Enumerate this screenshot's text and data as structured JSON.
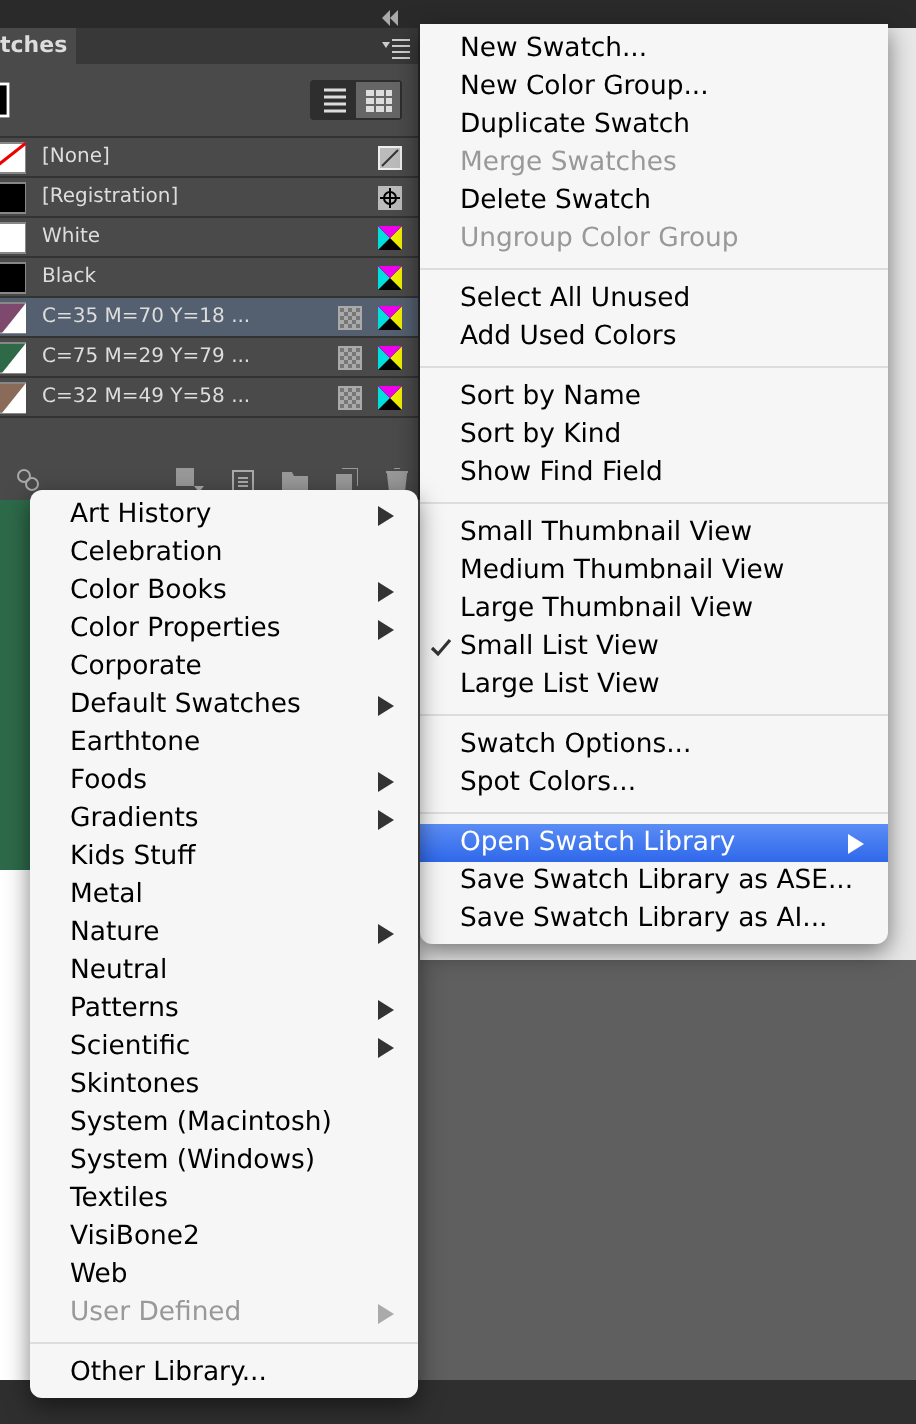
{
  "panel": {
    "tab": "tches",
    "swatches": [
      {
        "name": "[None]",
        "color": "#ffffff",
        "kind": "none",
        "selected": false,
        "global": false
      },
      {
        "name": "[Registration]",
        "color": "#000000",
        "kind": "registration",
        "selected": false,
        "global": false
      },
      {
        "name": "White",
        "color": "#ffffff",
        "kind": "process",
        "selected": false,
        "global": false
      },
      {
        "name": "Black",
        "color": "#000000",
        "kind": "process",
        "selected": false,
        "global": false
      },
      {
        "name": "C=35 M=70 Y=18 ...",
        "color": "#7d4a6e",
        "kind": "process",
        "selected": true,
        "global": true
      },
      {
        "name": "C=75 M=29 Y=79 ...",
        "color": "#2e6a48",
        "kind": "process",
        "selected": false,
        "global": true
      },
      {
        "name": "C=32 M=49 Y=58 ...",
        "color": "#8a6a58",
        "kind": "process",
        "selected": false,
        "global": true
      }
    ]
  },
  "menu": {
    "sections": [
      [
        {
          "label": "New Swatch...",
          "disabled": false,
          "checked": false,
          "submenu": false,
          "selected": false
        },
        {
          "label": "New Color Group...",
          "disabled": false,
          "checked": false,
          "submenu": false,
          "selected": false
        },
        {
          "label": "Duplicate Swatch",
          "disabled": false,
          "checked": false,
          "submenu": false,
          "selected": false
        },
        {
          "label": "Merge Swatches",
          "disabled": true,
          "checked": false,
          "submenu": false,
          "selected": false
        },
        {
          "label": "Delete Swatch",
          "disabled": false,
          "checked": false,
          "submenu": false,
          "selected": false
        },
        {
          "label": "Ungroup Color Group",
          "disabled": true,
          "checked": false,
          "submenu": false,
          "selected": false
        }
      ],
      [
        {
          "label": "Select All Unused",
          "disabled": false,
          "checked": false,
          "submenu": false,
          "selected": false
        },
        {
          "label": "Add Used Colors",
          "disabled": false,
          "checked": false,
          "submenu": false,
          "selected": false
        }
      ],
      [
        {
          "label": "Sort by Name",
          "disabled": false,
          "checked": false,
          "submenu": false,
          "selected": false
        },
        {
          "label": "Sort by Kind",
          "disabled": false,
          "checked": false,
          "submenu": false,
          "selected": false
        },
        {
          "label": "Show Find Field",
          "disabled": false,
          "checked": false,
          "submenu": false,
          "selected": false
        }
      ],
      [
        {
          "label": "Small Thumbnail View",
          "disabled": false,
          "checked": false,
          "submenu": false,
          "selected": false
        },
        {
          "label": "Medium Thumbnail View",
          "disabled": false,
          "checked": false,
          "submenu": false,
          "selected": false
        },
        {
          "label": "Large Thumbnail View",
          "disabled": false,
          "checked": false,
          "submenu": false,
          "selected": false
        },
        {
          "label": "Small List View",
          "disabled": false,
          "checked": true,
          "submenu": false,
          "selected": false
        },
        {
          "label": "Large List View",
          "disabled": false,
          "checked": false,
          "submenu": false,
          "selected": false
        }
      ],
      [
        {
          "label": "Swatch Options...",
          "disabled": false,
          "checked": false,
          "submenu": false,
          "selected": false
        },
        {
          "label": "Spot Colors...",
          "disabled": false,
          "checked": false,
          "submenu": false,
          "selected": false
        }
      ],
      [
        {
          "label": "Open Swatch Library",
          "disabled": false,
          "checked": false,
          "submenu": true,
          "selected": true
        },
        {
          "label": "Save Swatch Library as ASE...",
          "disabled": false,
          "checked": false,
          "submenu": false,
          "selected": false
        },
        {
          "label": "Save Swatch Library as AI...",
          "disabled": false,
          "checked": false,
          "submenu": false,
          "selected": false
        }
      ]
    ]
  },
  "library_menu": {
    "sections": [
      [
        {
          "label": "Art History",
          "disabled": false,
          "submenu": true
        },
        {
          "label": "Celebration",
          "disabled": false,
          "submenu": false
        },
        {
          "label": "Color Books",
          "disabled": false,
          "submenu": true
        },
        {
          "label": "Color Properties",
          "disabled": false,
          "submenu": true
        },
        {
          "label": "Corporate",
          "disabled": false,
          "submenu": false
        },
        {
          "label": "Default Swatches",
          "disabled": false,
          "submenu": true
        },
        {
          "label": "Earthtone",
          "disabled": false,
          "submenu": false
        },
        {
          "label": "Foods",
          "disabled": false,
          "submenu": true
        },
        {
          "label": "Gradients",
          "disabled": false,
          "submenu": true
        },
        {
          "label": "Kids Stuff",
          "disabled": false,
          "submenu": false
        },
        {
          "label": "Metal",
          "disabled": false,
          "submenu": false
        },
        {
          "label": "Nature",
          "disabled": false,
          "submenu": true
        },
        {
          "label": "Neutral",
          "disabled": false,
          "submenu": false
        },
        {
          "label": "Patterns",
          "disabled": false,
          "submenu": true
        },
        {
          "label": "Scientific",
          "disabled": false,
          "submenu": true
        },
        {
          "label": "Skintones",
          "disabled": false,
          "submenu": false
        },
        {
          "label": "System (Macintosh)",
          "disabled": false,
          "submenu": false
        },
        {
          "label": "System (Windows)",
          "disabled": false,
          "submenu": false
        },
        {
          "label": "Textiles",
          "disabled": false,
          "submenu": false
        },
        {
          "label": "VisiBone2",
          "disabled": false,
          "submenu": false
        },
        {
          "label": "Web",
          "disabled": false,
          "submenu": false
        },
        {
          "label": "User Defined",
          "disabled": true,
          "submenu": true
        }
      ],
      [
        {
          "label": "Other Library...",
          "disabled": false,
          "submenu": false
        }
      ]
    ]
  }
}
